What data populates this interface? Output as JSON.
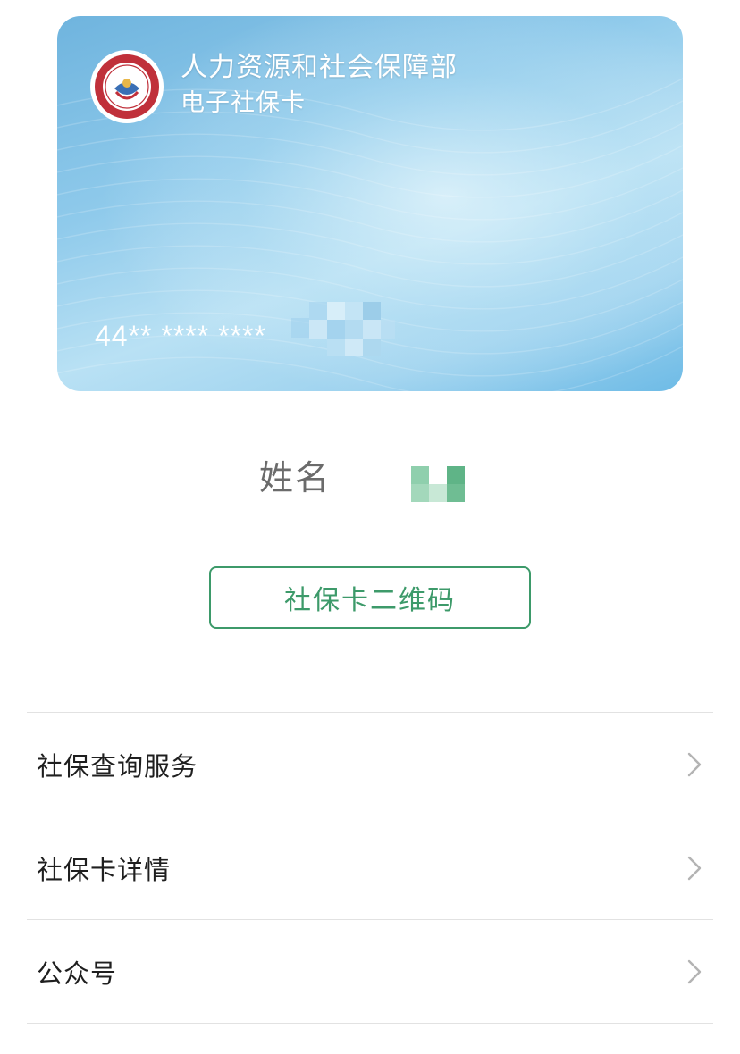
{
  "card": {
    "title": "人力资源和社会保障部",
    "subtitle": "电子社保卡",
    "number_masked": "44** **** ****",
    "logo_icon": "social-security-card-logo-icon",
    "colors": {
      "card_blue": "#8fcaeb",
      "logo_red": "#c0303a"
    }
  },
  "holder": {
    "name_label": "姓名"
  },
  "qr_button": {
    "label": "社保卡二维码",
    "color": "#3d9a6a"
  },
  "menu": {
    "items": [
      {
        "label": "社保查询服务",
        "icon": "chevron-right-icon"
      },
      {
        "label": "社保卡详情",
        "icon": "chevron-right-icon"
      },
      {
        "label": "公众号",
        "icon": "chevron-right-icon"
      }
    ]
  }
}
